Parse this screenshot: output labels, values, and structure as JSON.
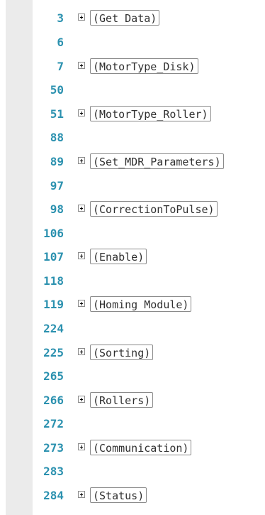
{
  "lines": [
    {
      "number": "3",
      "region": "(Get Data)"
    },
    {
      "number": "6",
      "region": ""
    },
    {
      "number": "7",
      "region": "(MotorType_Disk)"
    },
    {
      "number": "50",
      "region": ""
    },
    {
      "number": "51",
      "region": "(MotorType_Roller)"
    },
    {
      "number": "88",
      "region": ""
    },
    {
      "number": "89",
      "region": "(Set_MDR_Parameters)"
    },
    {
      "number": "97",
      "region": ""
    },
    {
      "number": "98",
      "region": "(CorrectionToPulse)"
    },
    {
      "number": "106",
      "region": ""
    },
    {
      "number": "107",
      "region": "(Enable)"
    },
    {
      "number": "118",
      "region": ""
    },
    {
      "number": "119",
      "region": "(Homing Module)"
    },
    {
      "number": "224",
      "region": ""
    },
    {
      "number": "225",
      "region": "(Sorting)"
    },
    {
      "number": "265",
      "region": ""
    },
    {
      "number": "266",
      "region": "(Rollers)"
    },
    {
      "number": "272",
      "region": ""
    },
    {
      "number": "273",
      "region": "(Communication)"
    },
    {
      "number": "283",
      "region": ""
    },
    {
      "number": "284",
      "region": "(Status)"
    }
  ],
  "colors": {
    "line_number": "#2b91af",
    "margin": "#ebebeb",
    "region_text": "#303030",
    "region_border": "#8a8a8a"
  },
  "icons": {
    "fold": "expand-plus-icon"
  }
}
